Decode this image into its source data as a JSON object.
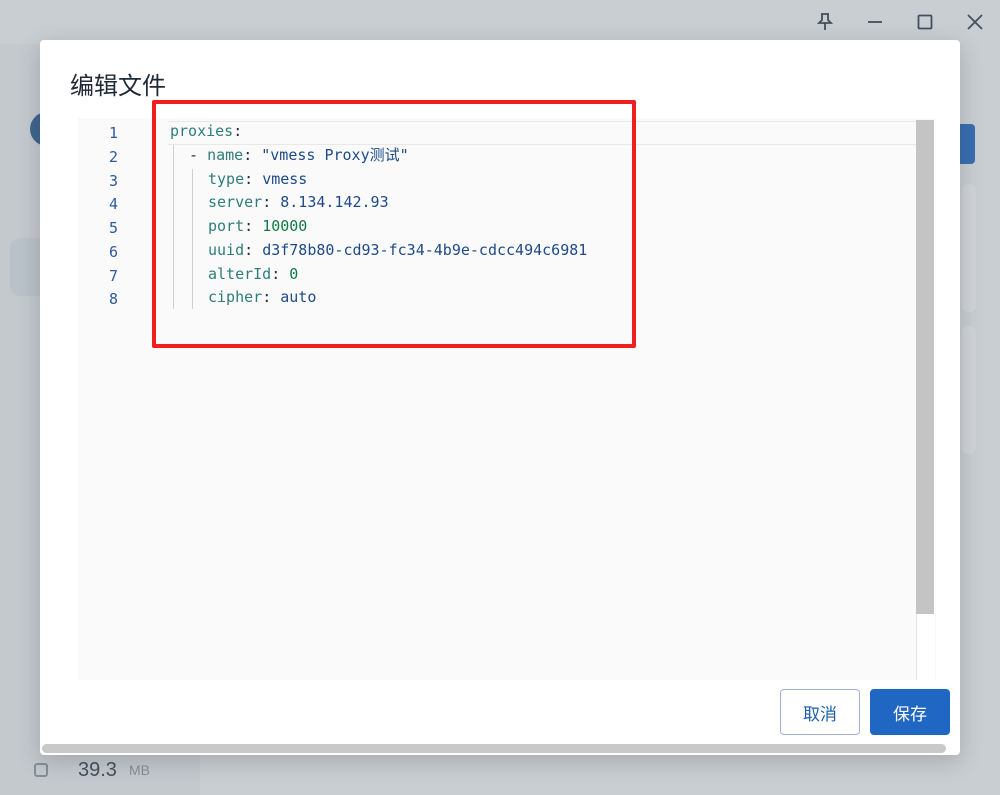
{
  "window": {
    "pin_icon": "pin-icon",
    "maximize_icon": "maximize-icon",
    "close_icon": "close-icon"
  },
  "background": {
    "memory_value": "39.3",
    "memory_unit": "MB"
  },
  "dialog": {
    "title": "编辑文件",
    "cancel_label": "取消",
    "save_label": "保存"
  },
  "editor": {
    "line_numbers": [
      "1",
      "2",
      "3",
      "4",
      "5",
      "6",
      "7",
      "8"
    ],
    "lines": [
      {
        "key": "proxies",
        "sep": ":",
        "value": ""
      },
      {
        "dash": "- ",
        "key": "name",
        "sep": ": ",
        "value": "\"vmess Proxy测试\""
      },
      {
        "key": "type",
        "sep": ": ",
        "value": "vmess"
      },
      {
        "key": "server",
        "sep": ": ",
        "value": "8.134.142.93"
      },
      {
        "key": "port",
        "sep": ": ",
        "value": "10000"
      },
      {
        "key": "uuid",
        "sep": ": ",
        "value": "d3f78b80-cd93-fc34-4b9e-cdcc494c6981"
      },
      {
        "key": "alterId",
        "sep": ": ",
        "value": "0"
      },
      {
        "key": "cipher",
        "sep": ": ",
        "value": "auto"
      }
    ]
  },
  "colors": {
    "accent": "#1f67c2",
    "highlight_box": "#f01e1e"
  }
}
